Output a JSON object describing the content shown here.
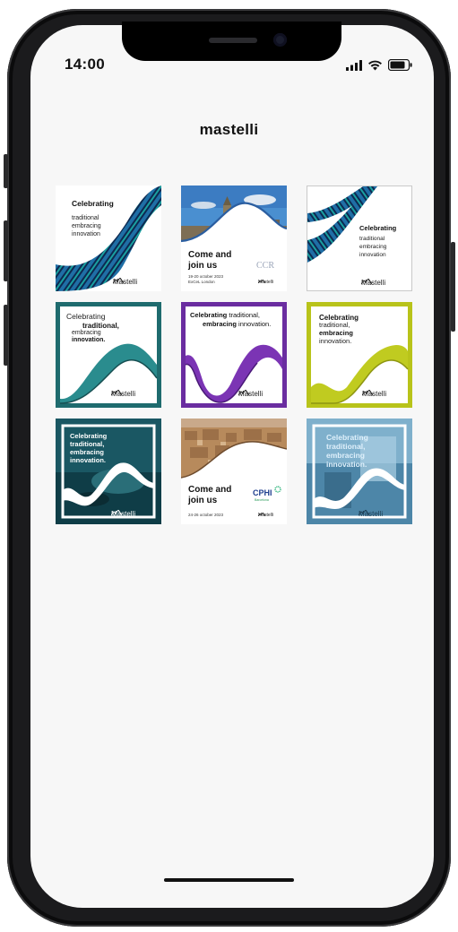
{
  "status": {
    "time": "14:00"
  },
  "app": {
    "title": "mastelli"
  },
  "tiles": [
    {
      "lines": [
        "Celebrating",
        "traditional",
        "embracing",
        "innovation"
      ],
      "logo": "Mastelli"
    },
    {
      "headline1": "Come and",
      "headline2": "join us",
      "badge": "CCR",
      "date": "19-20 october 2023",
      "venue": "ExCeL London",
      "logo": "Mastelli"
    },
    {
      "lines": [
        "Celebrating",
        "traditional",
        "embracing",
        "innovation"
      ],
      "logo": "Mastelli"
    },
    {
      "lines": [
        "Celebrating",
        "traditional,",
        "embracing",
        "innovation."
      ],
      "logo": "Mastelli",
      "accent": "#1e6b6e"
    },
    {
      "line1a": "Celebrating",
      "line1b": "traditional,",
      "line2a": "embracing",
      "line2b": "innovation.",
      "logo": "Mastelli",
      "accent": "#6a2da0"
    },
    {
      "lines": [
        "Celebrating",
        "traditional,",
        "embracing",
        "innovation."
      ],
      "logo": "Mastelli",
      "accent": "#b8c31a"
    },
    {
      "lines": [
        "Celebrating",
        "traditional,",
        "embracing",
        "innovation."
      ],
      "logo": "Mastelli"
    },
    {
      "headline1": "Come and",
      "headline2": "join us",
      "badge": "CPHI",
      "badge_sub": "Barcelona",
      "date": "24-26 october 2023",
      "logo": "Mastelli"
    },
    {
      "lines": [
        "Celebrating",
        "traditional,",
        "embracing",
        "innovation."
      ],
      "logo": "Mastelli"
    }
  ]
}
